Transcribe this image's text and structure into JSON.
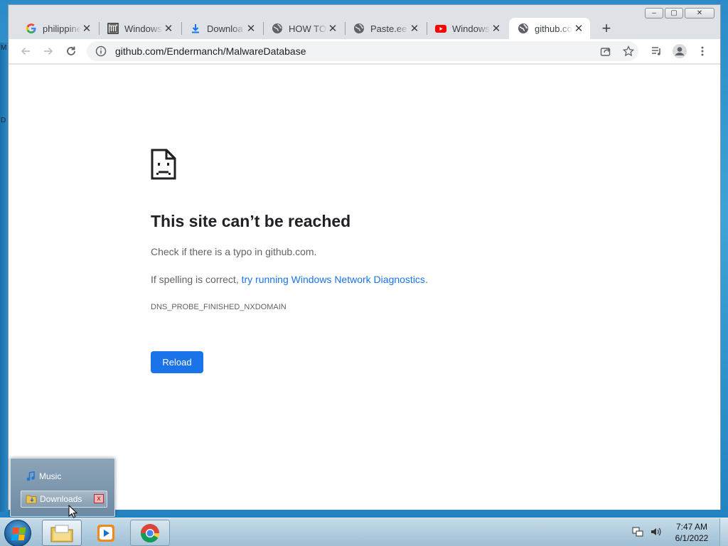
{
  "window": {
    "controls": {
      "minimize": "–",
      "maximize": "▢",
      "close": "✕"
    }
  },
  "tabs": [
    {
      "title": "philippine",
      "icon": "google-icon",
      "close": "✕"
    },
    {
      "title": "Windows",
      "icon": "archive-icon",
      "close": "✕"
    },
    {
      "title": "Downloa",
      "icon": "download-icon",
      "close": "✕"
    },
    {
      "title": "HOW TO",
      "icon": "globe-icon",
      "close": "✕"
    },
    {
      "title": "Paste.ee",
      "icon": "globe-icon",
      "close": "✕"
    },
    {
      "title": "Windows",
      "icon": "youtube-icon",
      "close": "✕"
    },
    {
      "title": "github.co",
      "icon": "globe-icon",
      "close": "✕",
      "active": true
    }
  ],
  "new_tab_label": "+",
  "address_bar": {
    "url": "github.com/Endermanch/MalwareDatabase"
  },
  "error_page": {
    "title": "This site can’t be reached",
    "line1": "Check if there is a typo in github.com.",
    "line2_prefix": "If spelling is correct, ",
    "line2_link": "try running Windows Network Diagnostics",
    "line2_suffix": ".",
    "error_code": "DNS_PROBE_FINISHED_NXDOMAIN",
    "reload_label": "Reload"
  },
  "jump_list": {
    "items": [
      {
        "label": "Music",
        "icon": "music-icon"
      },
      {
        "label": "Downloads",
        "icon": "downloads-folder-icon",
        "highlighted": true
      }
    ],
    "close_label": "x"
  },
  "taskbar": {
    "apps": [
      "explorer-icon",
      "media-player-icon",
      "chrome-icon"
    ],
    "clock": {
      "time": "7:47 AM",
      "date": "6/1/2022"
    }
  },
  "desktop_edge": {
    "labels": [
      "M",
      "D"
    ]
  },
  "colors": {
    "accent": "#1a73e8",
    "tab_bar": "#dee1e6",
    "error_text": "#5f6368"
  }
}
